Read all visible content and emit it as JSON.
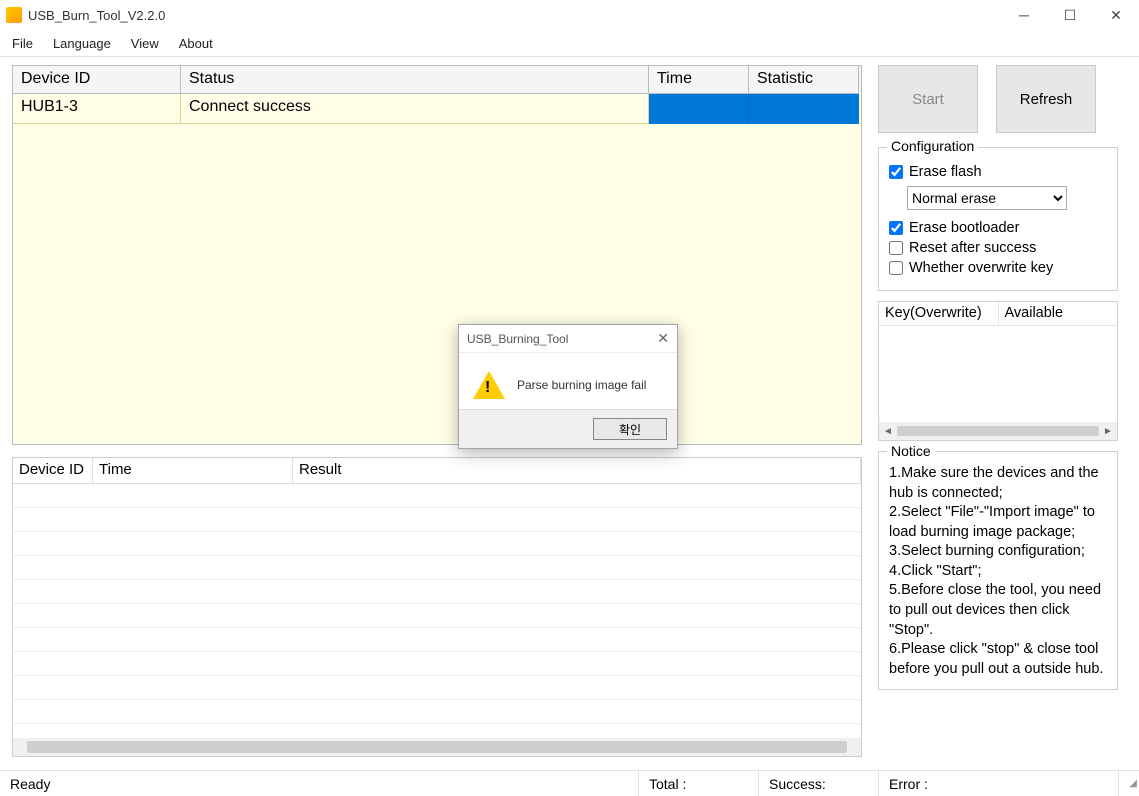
{
  "window": {
    "title": "USB_Burn_Tool_V2.2.0"
  },
  "menu": {
    "file": "File",
    "language": "Language",
    "view": "View",
    "about": "About"
  },
  "grid1": {
    "headers": {
      "device": "Device ID",
      "status": "Status",
      "time": "Time",
      "statistic": "Statistic"
    },
    "row": {
      "device": "HUB1-3",
      "status": "Connect success",
      "time": "",
      "statistic": ""
    }
  },
  "grid2": {
    "headers": {
      "device": "Device ID",
      "time": "Time",
      "result": "Result"
    }
  },
  "buttons": {
    "start": "Start",
    "refresh": "Refresh"
  },
  "config": {
    "title": "Configuration",
    "erase_flash": "Erase flash",
    "erase_mode": "Normal erase",
    "erase_bootloader": "Erase bootloader",
    "reset_after": "Reset after success",
    "overwrite_key": "Whether overwrite key",
    "checked": {
      "erase_flash": true,
      "erase_bootloader": true,
      "reset_after": false,
      "overwrite_key": false
    }
  },
  "keybox": {
    "col1": "Key(Overwrite)",
    "col2": "Available"
  },
  "notice": {
    "title": "Notice",
    "lines": [
      "1.Make sure the devices and the hub is connected;",
      "2.Select \"File\"-\"Import image\" to load burning image package;",
      "3.Select burning configuration;",
      "4.Click \"Start\";",
      "5.Before close the tool, you need to pull out devices then click \"Stop\".",
      "6.Please click \"stop\" & close tool before you pull out a outside hub."
    ]
  },
  "status": {
    "ready": "Ready",
    "total": "Total :",
    "success": "Success:",
    "error": "Error :"
  },
  "dialog": {
    "title": "USB_Burning_Tool",
    "message": "Parse burning image fail",
    "ok": "확인"
  }
}
